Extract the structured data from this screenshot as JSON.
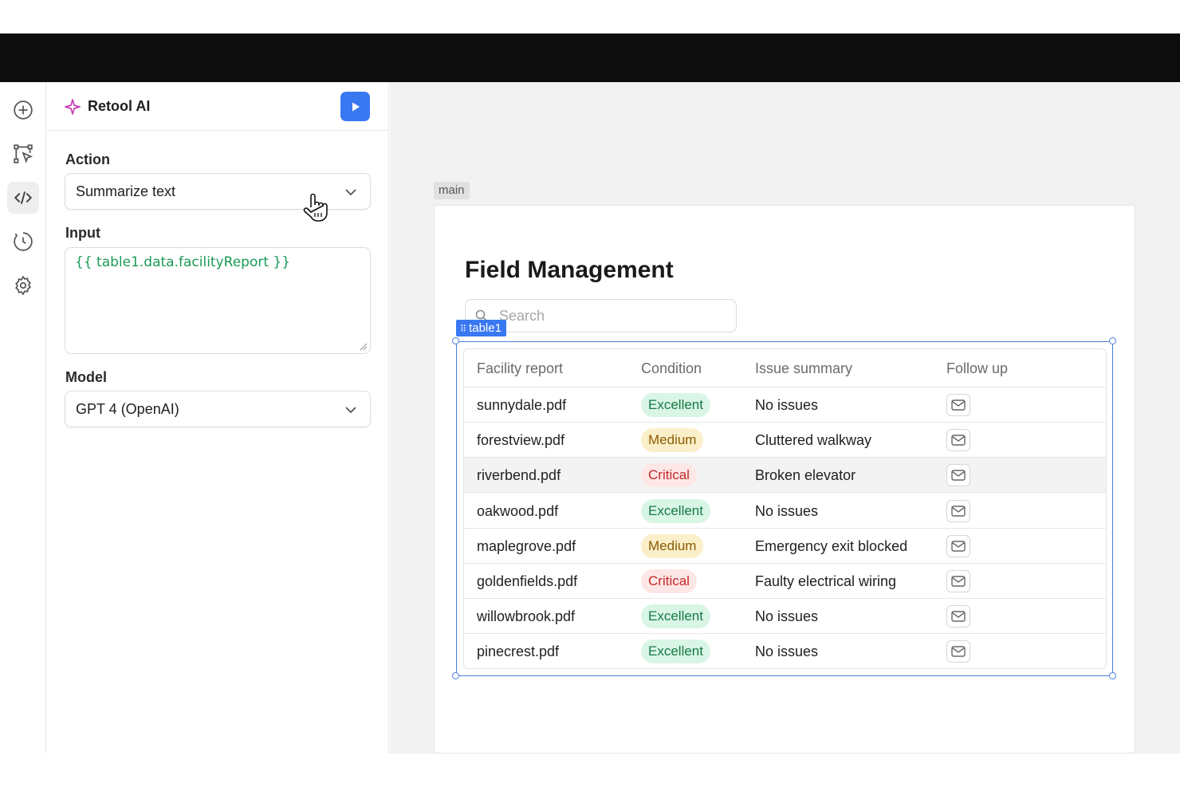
{
  "panel": {
    "title": "Retool AI",
    "action_label": "Action",
    "action_value": "Summarize text",
    "input_label": "Input",
    "input_value": "{{ table1.data.facilityReport }}",
    "model_label": "Model",
    "model_value": "GPT 4 (OpenAI)"
  },
  "canvas": {
    "frame_tag": "main",
    "app_title": "Field Management",
    "search_placeholder": "Search",
    "selected_component": "table1"
  },
  "table": {
    "columns": [
      "Facility report",
      "Condition",
      "Issue summary",
      "Follow up"
    ],
    "rows": [
      {
        "report": "sunnydale.pdf",
        "condition": "Excellent",
        "issue": "No issues"
      },
      {
        "report": "forestview.pdf",
        "condition": "Medium",
        "issue": "Cluttered walkway"
      },
      {
        "report": "riverbend.pdf",
        "condition": "Critical",
        "issue": "Broken elevator"
      },
      {
        "report": "oakwood.pdf",
        "condition": "Excellent",
        "issue": "No issues"
      },
      {
        "report": "maplegrove.pdf",
        "condition": "Medium",
        "issue": "Emergency exit blocked"
      },
      {
        "report": "goldenfields.pdf",
        "condition": "Critical",
        "issue": "Faulty electrical wiring"
      },
      {
        "report": "willowbrook.pdf",
        "condition": "Excellent",
        "issue": "No issues"
      },
      {
        "report": "pinecrest.pdf",
        "condition": "Excellent",
        "issue": "No issues"
      }
    ],
    "hovered_row": 2,
    "follow_up_icon": "mail-icon"
  },
  "colors": {
    "accent": "#3a78f2",
    "excellent_bg": "#d9f5e6",
    "excellent_fg": "#177a46",
    "medium_bg": "#fbefc9",
    "medium_fg": "#8a5a00",
    "critical_bg": "#fde6e6",
    "critical_fg": "#c62828"
  },
  "icons": {
    "rail": [
      "plus-circle-icon",
      "select-cursor-icon",
      "code-icon",
      "history-icon",
      "gear-icon"
    ],
    "panel": [
      "sparkle-icon",
      "play-icon",
      "chevron-down-icon"
    ]
  }
}
